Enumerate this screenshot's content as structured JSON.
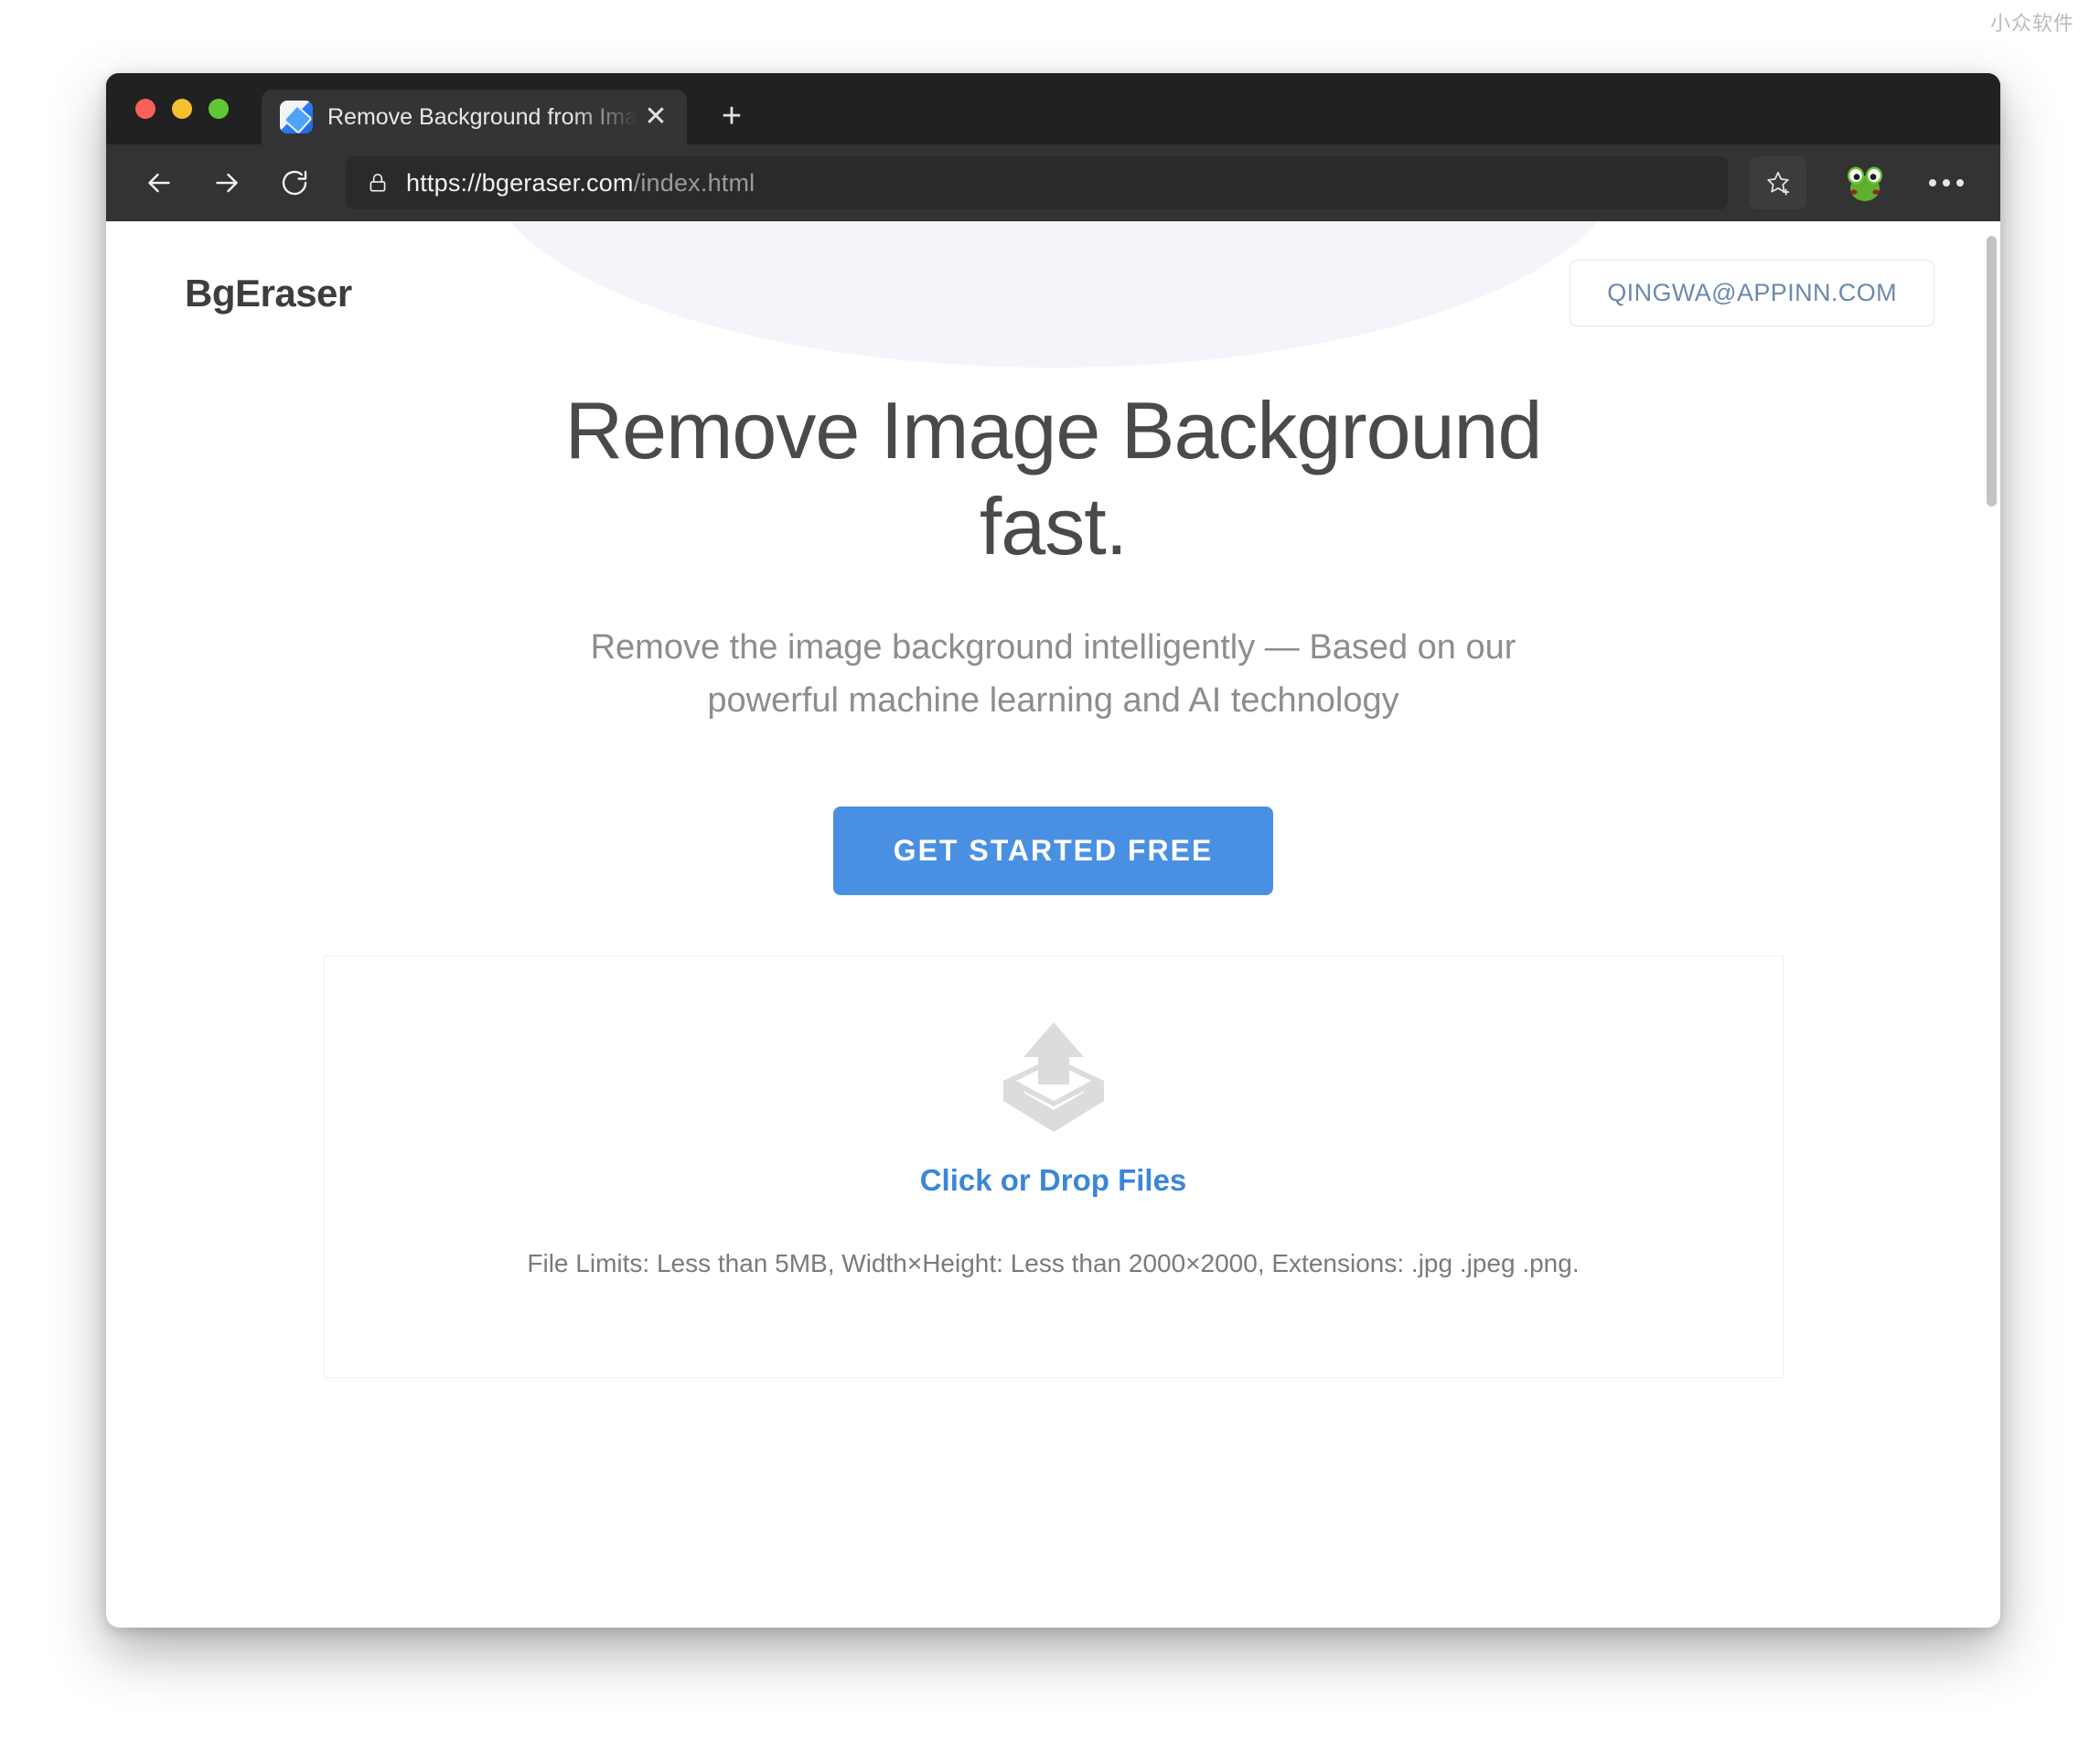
{
  "desktop": {
    "watermark": "小众软件"
  },
  "browser": {
    "traffic_lights": [
      {
        "name": "close",
        "color": "#f9605a"
      },
      {
        "name": "minimize",
        "color": "#f6c12e"
      },
      {
        "name": "maximize",
        "color": "#60c636"
      }
    ],
    "tab": {
      "title": "Remove Background from Image",
      "favicon": "eraser-icon",
      "close_label": "✕"
    },
    "new_tab_label": "+",
    "toolbar": {
      "back_icon": "back-arrow-icon",
      "forward_icon": "forward-arrow-icon",
      "reload_icon": "reload-icon",
      "lock_icon": "lock-icon",
      "url_origin": "https://bgeraser.com",
      "url_path": "/index.html",
      "bookmark_icon": "star-plus-icon",
      "avatar_icon": "frog-avatar-icon",
      "menu_icon": "more-options-icon"
    }
  },
  "page": {
    "brand": "BgEraser",
    "account_button": "QINGWA@APPINN.COM",
    "hero": {
      "title": "Remove Image Background fast.",
      "subtitle": "Remove the image background intelligently — Based on our powerful machine learning and AI technology",
      "cta": "GET STARTED FREE"
    },
    "dropzone": {
      "icon": "upload-box-icon",
      "title": "Click or Drop Files",
      "limits": "File Limits: Less than 5MB, Width×Height: Less than 2000×2000, Extensions: .jpg .jpeg .png."
    },
    "colors": {
      "accent_blue": "#4a90e2",
      "link_blue": "#3b86d8",
      "heading_gray": "#4a4a4a",
      "arc_lavender": "#f4f4fb"
    }
  }
}
